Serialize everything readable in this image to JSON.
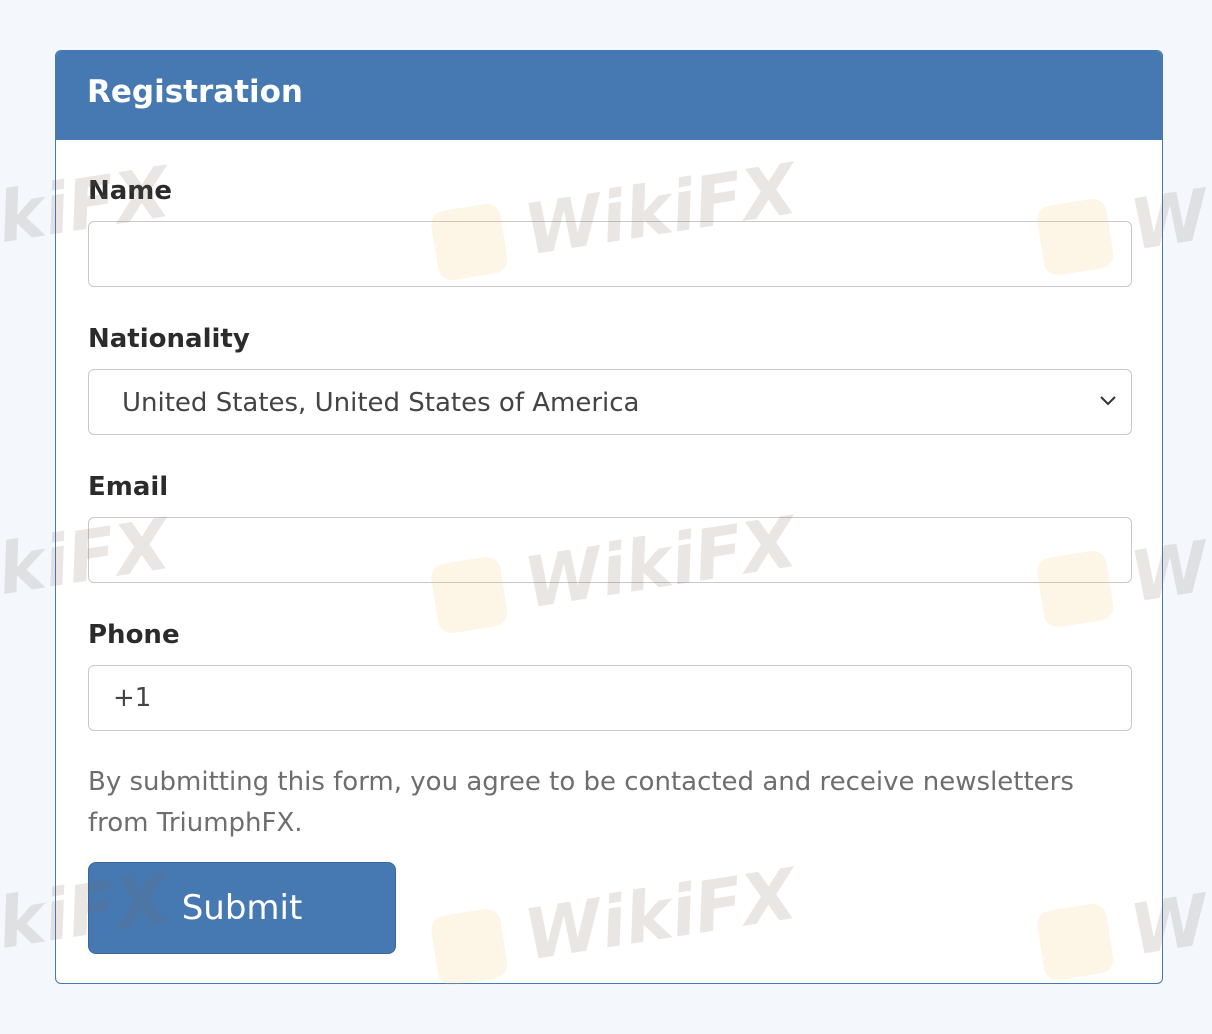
{
  "form": {
    "title": "Registration",
    "name_label": "Name",
    "name_value": "",
    "nationality_label": "Nationality",
    "nationality_value": "United States, United States of America",
    "email_label": "Email",
    "email_value": "",
    "phone_label": "Phone",
    "phone_value": "+1",
    "notice": "By submitting this form, you agree to be contacted and receive newsletters from TriumphFX.",
    "submit_label": "Submit"
  },
  "watermark": {
    "text": "WikiFX",
    "partial_left": "kiFX",
    "partial_right": "Wi"
  },
  "colors": {
    "accent": "#4679b2",
    "background": "#f4f8fc",
    "label": "#2b2b2b",
    "notice_text": "#6e6e6e",
    "field_border": "#c9c9c9"
  },
  "icons": {
    "dropdown": "chevron-down-icon",
    "watermark_logo": "wikifx-logo-icon"
  }
}
